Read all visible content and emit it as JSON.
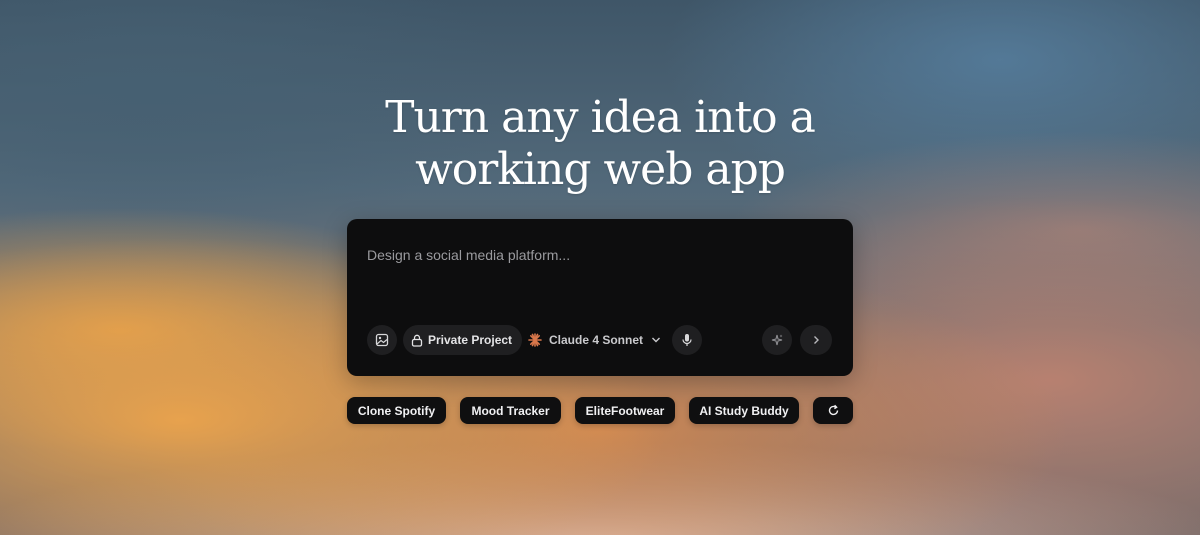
{
  "hero": {
    "title_line1": "Turn any idea into a",
    "title_line2": "working web app"
  },
  "prompt": {
    "placeholder": "Design a social media platform...",
    "value": ""
  },
  "toolbar": {
    "attach_icon": "image-icon",
    "privacy_label": "Private Project",
    "privacy_icon": "lock-icon",
    "model_label": "Claude 4 Sonnet",
    "model_icon": "claude-sparkle-icon",
    "model_dropdown_icon": "chevron-down-icon",
    "mic_icon": "microphone-icon",
    "enhance_icon": "sparkles-icon",
    "send_icon": "chevron-right-icon"
  },
  "suggestions": [
    "Clone Spotify",
    "Mood Tracker",
    "EliteFootwear",
    "AI Study Buddy"
  ],
  "refresh_icon": "refresh-icon",
  "colors": {
    "prompt_bg": "#0d0d0e",
    "button_bg": "#1f1f21",
    "claude_accent": "#d9774b",
    "text_light": "#ffffff"
  }
}
